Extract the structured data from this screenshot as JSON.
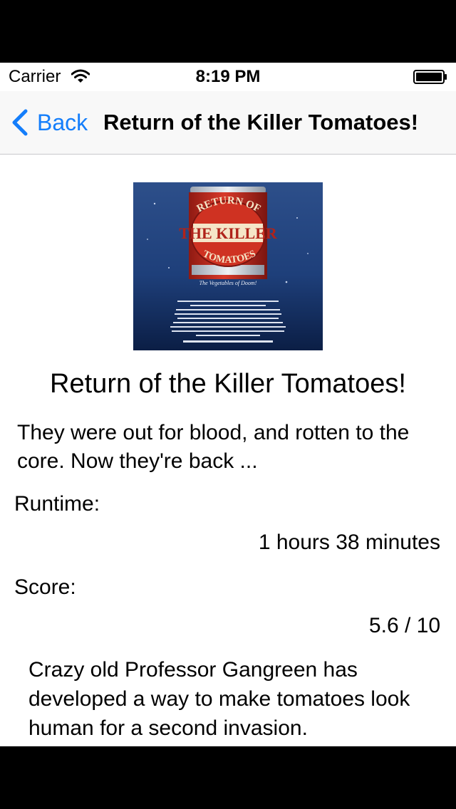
{
  "status_bar": {
    "carrier": "Carrier",
    "time": "8:19 PM",
    "wifi_icon": "wifi-icon",
    "battery_icon": "battery-icon"
  },
  "nav": {
    "back_label": "Back",
    "back_icon": "chevron-left-icon",
    "title": "Return of the Killer Tomatoes!",
    "accent_color": "#147efb"
  },
  "poster": {
    "arc_top": "RETURN OF",
    "main": "THE KILLER",
    "arc_bottom": "TOMATOES",
    "tagline": "The Vegetables of Doom!"
  },
  "movie": {
    "title": "Return of the Killer Tomatoes!",
    "tagline": "They were out for blood, and rotten to the core. Now they're back ...",
    "runtime_label": "Runtime:",
    "runtime_value": "1 hours 38 minutes",
    "score_label": "Score:",
    "score_value": "5.6 / 10",
    "overview": "Crazy old Professor Gangreen has developed a way to make tomatoes look human for a second invasion."
  }
}
